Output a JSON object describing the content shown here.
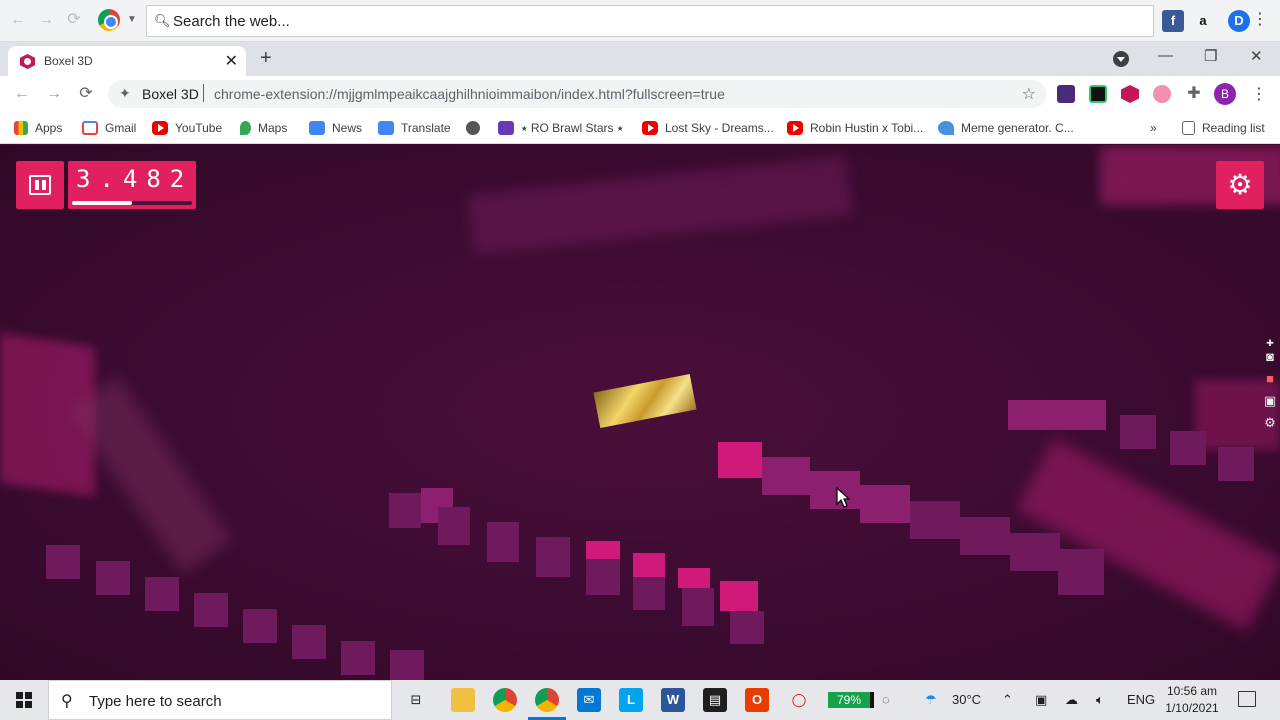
{
  "top_strip": {
    "search_placeholder": "Search the web..."
  },
  "tab": {
    "title": "Boxel 3D",
    "close": "✕",
    "new_tab": "+"
  },
  "window": {
    "minimize": "—",
    "restore": "❐",
    "close": "✕"
  },
  "address": {
    "site_name": "Boxel 3D",
    "url": "chrome-extension://mjjgmlmpeaikcaajghilhnioimmaibon/index.html?fullscreen=true",
    "profile_initial": "B"
  },
  "bookmarks": {
    "items": [
      {
        "label": "Apps"
      },
      {
        "label": "Gmail"
      },
      {
        "label": "YouTube"
      },
      {
        "label": "Maps"
      },
      {
        "label": "News"
      },
      {
        "label": "Translate"
      },
      {
        "label": ""
      },
      {
        "label": "⭑ RO Brawl Stars ⭑"
      },
      {
        "label": "Lost Sky - Dreams..."
      },
      {
        "label": "Robin Hustin x Tobi..."
      },
      {
        "label": "Meme generator. C..."
      }
    ],
    "overflow": "»",
    "reading_list": "Reading list"
  },
  "game": {
    "score": "3.482",
    "progress": 0.5,
    "settings_icon": "gear-icon"
  },
  "taskbar": {
    "search_placeholder": "Type here to search",
    "battery": "79%",
    "temperature": "30°C",
    "language": "ENG",
    "time": "10:56 am",
    "date": "1/10/2021"
  }
}
